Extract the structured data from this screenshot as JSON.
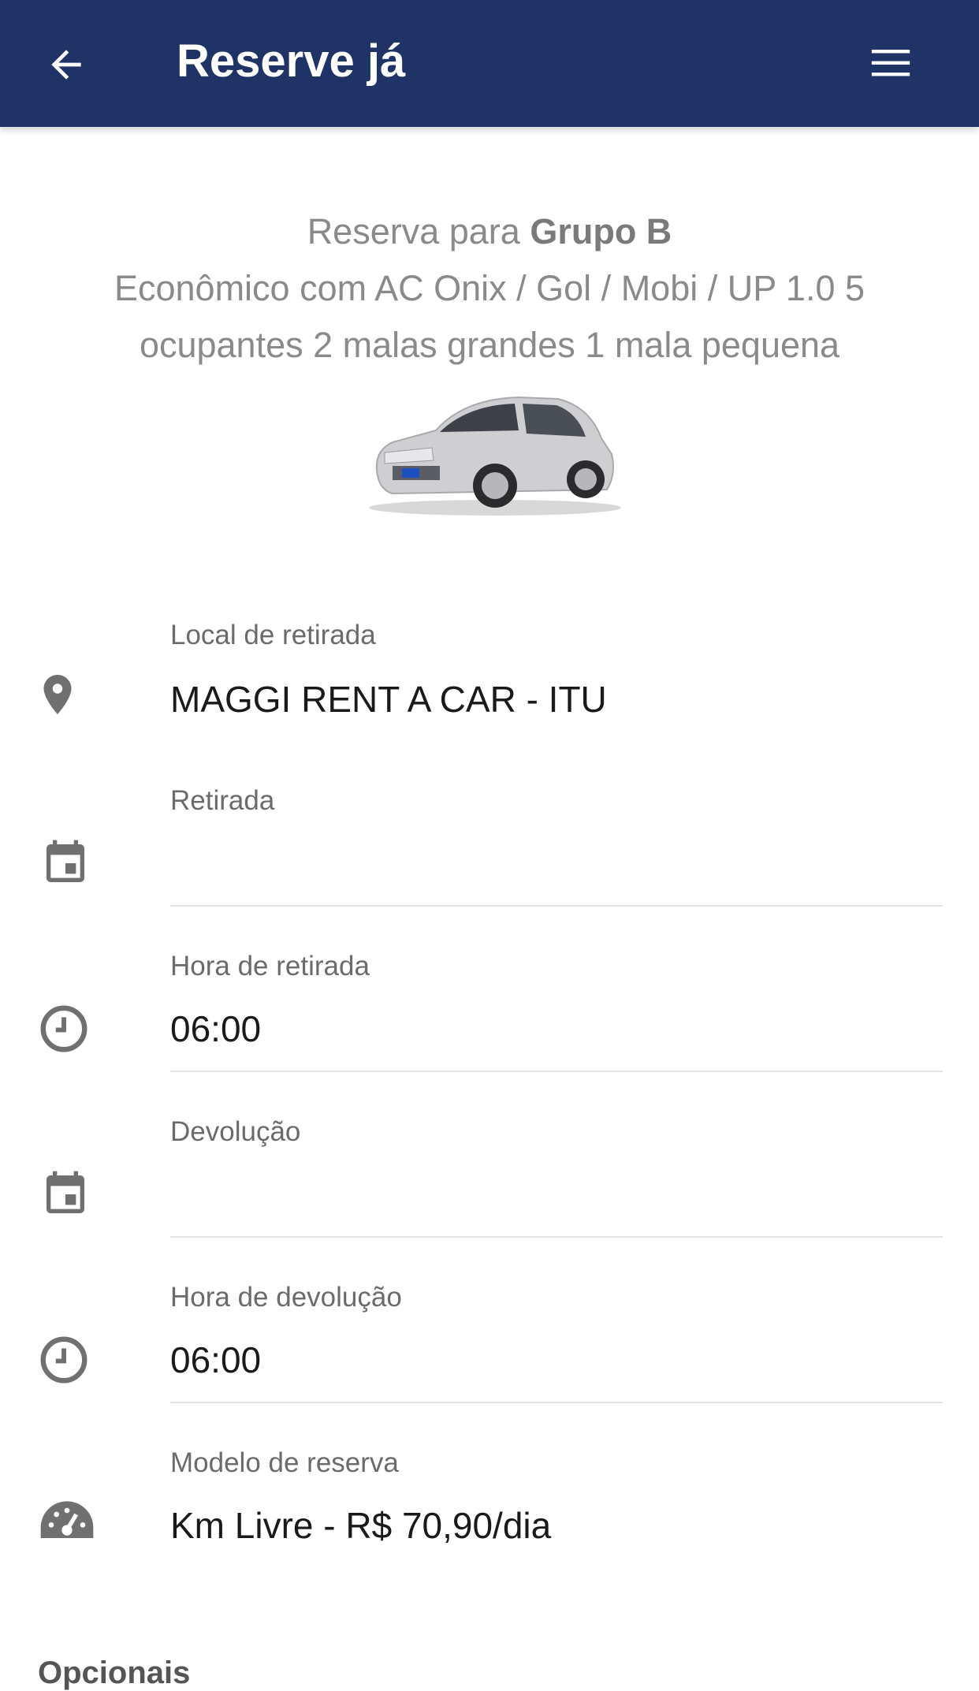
{
  "appbar": {
    "title": "Reserve já",
    "back_icon": "arrow-left-icon",
    "menu_icon": "hamburger-menu-icon",
    "background": "#1f3366"
  },
  "vehicle": {
    "prefix": "Reserva para ",
    "group": "Grupo B",
    "description_line1": "Econômico com AC Onix / Gol / Mobi / UP 1.0 5",
    "description_line2": "ocupantes 2 malas grandes 1 mala pequena",
    "image": "silver-hatchback-car"
  },
  "fields": {
    "pickup_location": {
      "label": "Local de retirada",
      "value": "MAGGI RENT A CAR - ITU",
      "icon": "map-pin-icon"
    },
    "pickup_date": {
      "label": "Retirada",
      "value": "",
      "icon": "calendar-icon"
    },
    "pickup_time": {
      "label": "Hora de retirada",
      "value": "06:00",
      "icon": "clock-icon"
    },
    "return_date": {
      "label": "Devolução",
      "value": "",
      "icon": "calendar-icon"
    },
    "return_time": {
      "label": "Hora de devolução",
      "value": "06:00",
      "icon": "clock-icon"
    },
    "reservation_model": {
      "label": "Modelo de reserva",
      "value": "Km Livre - R$ 70,90/dia",
      "icon": "speedometer-icon"
    }
  },
  "sections": {
    "optionals_title": "Opcionais"
  }
}
